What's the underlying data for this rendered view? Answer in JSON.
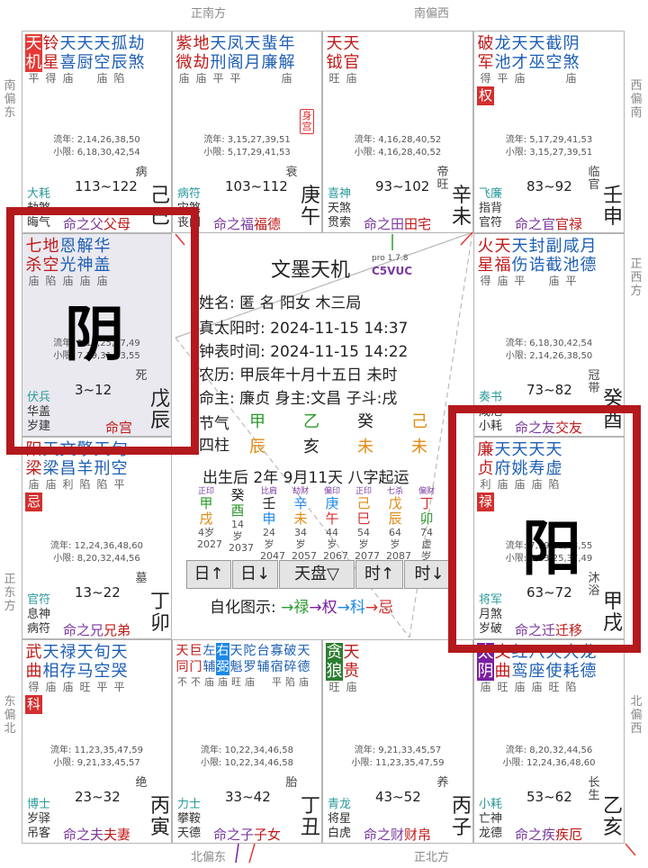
{
  "directions": {
    "top_left": "正南方",
    "top_right": "南偏西",
    "bottom_left": "北偏东",
    "bottom_right": "正北方",
    "left_top": "南偏东",
    "left_mid": "正东方",
    "left_bot": "东偏北",
    "right_top": "西偏南",
    "right_mid": "正西方",
    "right_bot": "北偏西"
  },
  "palaces": [
    {
      "stars": [
        {
          "c": "天机",
          "b": "平",
          "box": "#e53935"
        },
        {
          "c": "铃星",
          "b": "得"
        },
        {
          "c": "天喜",
          "b": "庙"
        },
        {
          "c": "天厨",
          "b": ""
        },
        {
          "c": "天空",
          "b": "庙"
        },
        {
          "c": "孤辰",
          "b": "陷"
        },
        {
          "c": "劫煞",
          "b": ""
        }
      ],
      "flows": "流年: 2,14,26,38,50",
      "xiao": "小限: 6,18,30,42,54",
      "god1": "大耗",
      "age": "113~122",
      "gods": [
        "劫煞",
        "晦气"
      ],
      "pre": "命之父",
      "name": "父母",
      "stage": "病",
      "gz": "己巳"
    },
    {
      "stars": [
        {
          "c": "紫微",
          "b": "庙"
        },
        {
          "c": "地劫",
          "b": "庙"
        },
        {
          "c": "天刑",
          "b": "平"
        },
        {
          "c": "凤阁",
          "b": "平"
        },
        {
          "c": "天月",
          "b": ""
        },
        {
          "c": "蜚廉",
          "b": ""
        },
        {
          "c": "年解",
          "b": "庙"
        }
      ],
      "flows": "流年: 3,15,27,39,51",
      "xiao": "小限: 5,17,29,41,53",
      "god1": "病符",
      "age": "103~112",
      "gods": [
        "灾煞",
        "丧门"
      ],
      "pre": "命之福",
      "name": "福德",
      "stage": "衰",
      "gz": "庚午",
      "stamp": "身宫"
    },
    {
      "stars": [
        {
          "c": "天钺",
          "b": "旺"
        },
        {
          "c": "天官",
          "b": "庙"
        }
      ],
      "flows": "流年: 4,16,28,40,52",
      "xiao": "小限: 4,16,28,40,52",
      "god1": "喜神",
      "age": "93~102",
      "gods": [
        "天煞",
        "贯索"
      ],
      "pre": "命之田",
      "name": "田宅",
      "stage": "帝旺",
      "gz": "辛未"
    },
    {
      "stars": [
        {
          "c": "破军",
          "b": "得",
          "badge": "权",
          "bc": "#d32f2f"
        },
        {
          "c": "龙池",
          "b": "平"
        },
        {
          "c": "天才",
          "b": "庙"
        },
        {
          "c": "天巫",
          "b": ""
        },
        {
          "c": "截空",
          "b": ""
        },
        {
          "c": "阴煞",
          "b": "庙"
        }
      ],
      "flows": "流年: 5,17,29,41,53",
      "xiao": "小限: 3,15,27,39,51",
      "god1": "飞廉",
      "age": "83~92",
      "gods": [
        "指背",
        "官符"
      ],
      "pre": "命之官",
      "name": "官禄",
      "stage": "临官",
      "gz": "壬申"
    },
    {
      "stars": [
        {
          "c": "火星",
          "b": "得"
        },
        {
          "c": "天福",
          "b": "庙"
        },
        {
          "c": "天伤",
          "b": "平"
        },
        {
          "c": "封诰",
          "b": ""
        },
        {
          "c": "副截",
          "b": "庙"
        },
        {
          "c": "咸池",
          "b": "平"
        },
        {
          "c": "月德",
          "b": ""
        }
      ],
      "flows": "流年: 6,18,30,42,54",
      "xiao": "小限: 2,14,26,38,50",
      "god1": "奏书",
      "age": "73~82",
      "gods": [
        "咸池",
        "小耗"
      ],
      "pre": "命之友",
      "name": "交友",
      "stage": "冠带",
      "gz": "癸酉"
    },
    {
      "stars": [
        {
          "c": "廉贞",
          "b": "利",
          "badge": "禄",
          "bc": "#d32f2f"
        },
        {
          "c": "天府",
          "b": "庙"
        },
        {
          "c": "天姚",
          "b": "庙"
        },
        {
          "c": "天寿",
          "b": "庙"
        },
        {
          "c": "天虚",
          "b": "陷"
        }
      ],
      "flows": "流年: 7,19,31,43,55",
      "xiao": "小限: 1,13,25,37,49",
      "god1": "将军",
      "age": "63~72",
      "gods": [
        "月煞",
        "岁破"
      ],
      "pre": "命之迁",
      "name": "迁移",
      "stage": "沐浴",
      "gz": "甲戌"
    },
    {
      "stars": [
        {
          "c": "太阴",
          "b": "庙",
          "box": "#7b1fa2"
        },
        {
          "c": "文曲",
          "b": "旺"
        },
        {
          "c": "红鸾",
          "b": "庙"
        },
        {
          "c": "八座",
          "b": "庙"
        },
        {
          "c": "天使",
          "b": "旺"
        },
        {
          "c": "大耗",
          "b": "陷"
        },
        {
          "c": "龙德",
          "b": ""
        }
      ],
      "flows": "流年: 8,20,32,44,56",
      "xiao": "小限: 12,24,36,48,60",
      "god1": "小耗",
      "age": "53~62",
      "gods": [
        "亡神",
        "龙德"
      ],
      "pre": "命之疾",
      "name": "疾厄",
      "stage": "长生",
      "gz": "乙亥"
    },
    {
      "stars": [
        {
          "c": "贪狼",
          "b": "旺",
          "box": "#2e7d32"
        },
        {
          "c": "天贵",
          "b": "庙"
        }
      ],
      "flows": "流年: 9,21,33,45,57",
      "xiao": "小限: 11,23,35,47,59",
      "god1": "青龙",
      "age": "43~52",
      "gods": [
        "将星",
        "白虎"
      ],
      "pre": "命之财",
      "name": "财帛",
      "stage": "养",
      "gz": "丙子"
    },
    {
      "stars": [
        {
          "c": "天同",
          "b": "不"
        },
        {
          "c": "巨门",
          "b": "不"
        },
        {
          "c": "左辅",
          "b": "庙"
        },
        {
          "c": "右弼",
          "b": "庙",
          "box": "#1e88e5"
        },
        {
          "c": "天魁",
          "b": "旺"
        },
        {
          "c": "陀罗",
          "b": "庙"
        },
        {
          "c": "台辅",
          "b": ""
        },
        {
          "c": "寡宿",
          "b": "平"
        },
        {
          "c": "破碎",
          "b": "陷"
        },
        {
          "c": "天德",
          "b": "庙"
        }
      ],
      "flows": "流年: 10,22,34,46,58",
      "xiao": "小限: 10,22,34,46,58",
      "god1": "力士",
      "age": "33~42",
      "gods": [
        "攀鞍",
        "天德"
      ],
      "pre": "命之子",
      "name": "子女",
      "stage": "胎",
      "gz": "丁丑",
      "small": true
    },
    {
      "stars": [
        {
          "c": "武曲",
          "b": "得",
          "badge": "科",
          "bc": "#d32f2f"
        },
        {
          "c": "天相",
          "b": "庙"
        },
        {
          "c": "禄存",
          "b": "庙"
        },
        {
          "c": "天马",
          "b": "旺"
        },
        {
          "c": "旬空",
          "b": "平"
        },
        {
          "c": "天哭",
          "b": "平"
        }
      ],
      "flows": "流年: 11,23,35,47,59",
      "xiao": "小限: 9,21,33,45,57",
      "god1": "博士",
      "age": "23~32",
      "gods": [
        "岁驿",
        "吊客"
      ],
      "pre": "命之夫",
      "name": "夫妻",
      "stage": "绝",
      "gz": "丙寅"
    },
    {
      "stars": [
        {
          "c": "阳梁",
          "b": "庙",
          "badge": "忌",
          "bc": "#d32f2f"
        },
        {
          "c": "天梁",
          "b": "庙"
        },
        {
          "c": "文昌",
          "b": "利"
        },
        {
          "c": "擎羊",
          "b": "陷"
        },
        {
          "c": "天刑",
          "b": "陷"
        },
        {
          "c": "旬空",
          "b": "平"
        }
      ],
      "flows": "流年: 12,24,36,48,60",
      "xiao": "小限: 8,20,32,44,56",
      "god1": "官符",
      "age": "13~22",
      "gods": [
        "息神",
        "病符"
      ],
      "pre": "命之兄",
      "name": "兄弟",
      "stage": "墓",
      "gz": "丁卯"
    },
    {
      "stars": [
        {
          "c": "七杀",
          "b": "庙"
        },
        {
          "c": "地空",
          "b": "陷"
        },
        {
          "c": "恩光",
          "b": "庙"
        },
        {
          "c": "解神",
          "b": "庙"
        },
        {
          "c": "华盖",
          "b": "庙"
        }
      ],
      "flows": "流年: 1,13,25,37,49",
      "xiao": "小限: 7,19,31,43,55",
      "god1": "伏兵",
      "age": "3~12",
      "gods": [
        "华盖",
        "岁建"
      ],
      "pre": "",
      "name": "命宫",
      "stage": "死",
      "gz": "戊辰"
    }
  ],
  "center": {
    "title": "文墨天机",
    "pro": "pro 1.7.8",
    "code": "C5VUC",
    "name_line": "姓名: 匿 名            阳女 木三局",
    "solar_line": "真太阳时:   2024-11-15  14:37",
    "clock_line": "钟表时间:   2024-11-15  14:22",
    "lunar_line": "农历: 甲辰年十月十五日 未时",
    "master_line": "命主: 廉贞 身主:文昌  子斗:戌",
    "jieqi": "节气",
    "sizhu": "四柱",
    "stems": [
      {
        "t": "甲",
        "col": "#2e9a2e"
      },
      {
        "t": "乙",
        "col": "#2e9a2e"
      },
      {
        "t": "癸",
        "col": "#222"
      },
      {
        "t": "己",
        "col": "#e08a10"
      }
    ],
    "branches": [
      {
        "t": "辰",
        "col": "#e08a10"
      },
      {
        "t": "亥",
        "col": "#222"
      },
      {
        "t": "未",
        "col": "#e08a10"
      },
      {
        "t": "未",
        "col": "#e08a10"
      }
    ],
    "luck_line": "出生后 2年 9月11天 八字起运",
    "decades": [
      {
        "s": "正印",
        "g": "甲",
        "gc": "#2e9a2e",
        "b": "戌",
        "bc": "#e08a10",
        "a": "4岁",
        "y": "2027"
      },
      {
        "s": "",
        "g": "癸",
        "gc": "#222",
        "b": "酉",
        "bc": "#2e9a2e",
        "a": "14岁",
        "y": "2037"
      },
      {
        "s": "比肩",
        "g": "壬",
        "gc": "#222",
        "b": "申",
        "bc": "#1e88e5",
        "a": "24岁",
        "y": "2047"
      },
      {
        "s": "劫财",
        "g": "辛",
        "gc": "#1e88e5",
        "b": "未",
        "bc": "#e08a10",
        "a": "34岁",
        "y": "2057"
      },
      {
        "s": "偏印",
        "g": "庚",
        "gc": "#1e88e5",
        "b": "午",
        "bc": "#d32f2f",
        "a": "44岁",
        "y": "2067"
      },
      {
        "s": "正印",
        "g": "己",
        "gc": "#e08a10",
        "b": "巳",
        "bc": "#d32f2f",
        "a": "54岁",
        "y": "2077"
      },
      {
        "s": "七杀",
        "g": "戊",
        "gc": "#e08a10",
        "b": "辰",
        "bc": "#e08a10",
        "a": "64岁",
        "y": "2087"
      },
      {
        "s": "偏财",
        "g": "丁",
        "gc": "#d32f2f",
        "b": "卯",
        "bc": "#2e9a2e",
        "a": "74虚岁",
        "y": "2097"
      }
    ],
    "buttons": [
      "日↑",
      "日↓",
      "天盘▽",
      "时↑",
      "时↓"
    ],
    "legend": {
      "label": "自化图示: ",
      "lu": "→禄",
      "quan": "→权",
      "ke": "→科",
      "ji": "→忌"
    }
  },
  "overlay": {
    "yin": "阴",
    "yang": "阳"
  }
}
